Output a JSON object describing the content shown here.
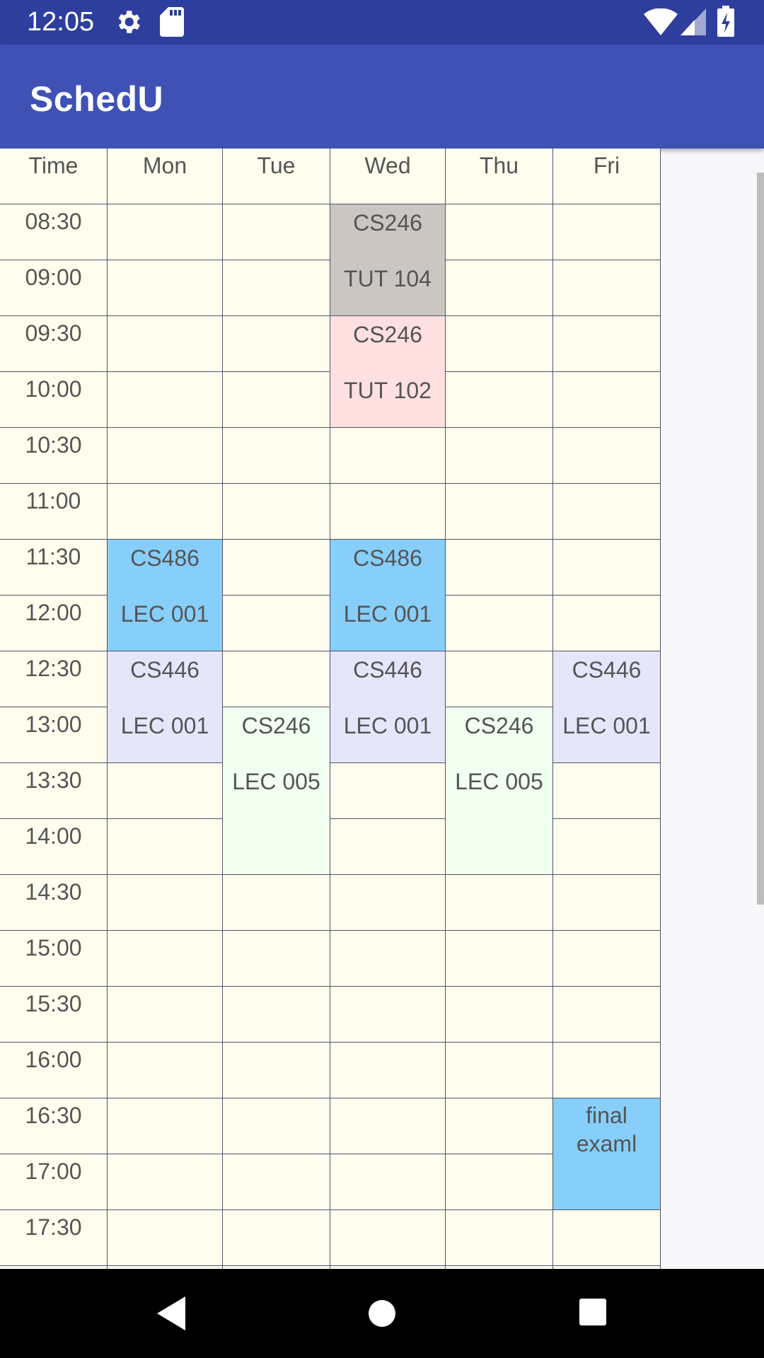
{
  "status_bar": {
    "time": "12:05",
    "icons": [
      "gear-icon",
      "sd-card-icon",
      "wifi-icon",
      "signal-icon",
      "battery-charging-icon"
    ]
  },
  "app_bar": {
    "title": "SchedU"
  },
  "timetable": {
    "headers": [
      "Time",
      "Mon",
      "Tue",
      "Wed",
      "Thu",
      "Fri"
    ],
    "times": [
      "08:30",
      "09:00",
      "09:30",
      "10:00",
      "10:30",
      "11:00",
      "11:30",
      "12:00",
      "12:30",
      "13:00",
      "13:30",
      "14:00",
      "14:30",
      "15:00",
      "15:30",
      "16:00",
      "16:30",
      "17:00",
      "17:30"
    ],
    "events": [
      {
        "day": 3,
        "start": 0,
        "span": 2,
        "line1": "CS246",
        "line2": "TUT 104",
        "color": "#ccc6c2"
      },
      {
        "day": 3,
        "start": 2,
        "span": 2,
        "line1": "CS246",
        "line2": "TUT 102",
        "color": "#ffe0e0"
      },
      {
        "day": 1,
        "start": 6,
        "span": 2,
        "line1": "CS486",
        "line2": "LEC 001",
        "color": "#87cefa"
      },
      {
        "day": 3,
        "start": 6,
        "span": 2,
        "line1": "CS486",
        "line2": "LEC 001",
        "color": "#87cefa"
      },
      {
        "day": 1,
        "start": 8,
        "span": 2,
        "line1": "CS446",
        "line2": "LEC 001",
        "color": "#e6e6fa"
      },
      {
        "day": 3,
        "start": 8,
        "span": 2,
        "line1": "CS446",
        "line2": "LEC 001",
        "color": "#e6e6fa"
      },
      {
        "day": 5,
        "start": 8,
        "span": 2,
        "line1": "CS446",
        "line2": "LEC 001",
        "color": "#e6e6fa"
      },
      {
        "day": 2,
        "start": 9,
        "span": 3,
        "line1": "CS246",
        "line2": "LEC 005",
        "color": "#f0fff0"
      },
      {
        "day": 4,
        "start": 9,
        "span": 3,
        "line1": "CS246",
        "line2": "LEC 005",
        "color": "#f0fff0"
      },
      {
        "day": 5,
        "start": 16,
        "span": 2,
        "text": "final\nexaml",
        "color": "#87cefa"
      }
    ]
  },
  "nav_bar": {
    "buttons": [
      "back-icon",
      "home-icon",
      "recents-icon"
    ]
  }
}
